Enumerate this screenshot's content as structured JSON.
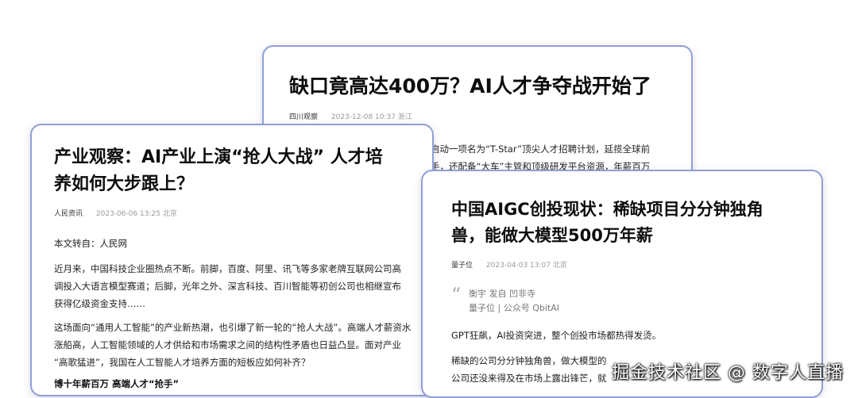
{
  "cards": [
    {
      "title": "缺口竟高达400万？AI人才争夺战开始了",
      "source": "四川观察",
      "date": "2023-12-08 10:37",
      "location": "浙江",
      "lines": [
        "启动一项名为“T-Star”顶尖人才招聘计划，延揽全球前",
        "手，还配备“大车”主管和顶级研发平台资源，年薪百万"
      ]
    },
    {
      "title_line1": "产业观察：AI产业上演“抢人大战” 人才培",
      "title_line2": "养如何大步跟上？",
      "source": "人民资讯",
      "date": "2023-06-06 13:25",
      "location": "北京",
      "repost": "本文转自：人民网",
      "p1": [
        "近月来，中国科技企业圈热点不断。前脚，百度、阿里、讯飞等多家老牌互联网公司高",
        "调投入大语言模型赛道；后脚，光年之外、深言科技、百川智能等初创公司也相继宣布",
        "获得亿级资金支持……"
      ],
      "p2": [
        "这场面向“通用人工智能”的产业新热潮，也引爆了新一轮的“抢人大战”。高端人才薪资水",
        "涨船高，人工智能领域的人才供给和市场需求之间的结构性矛盾也日益凸显。面对产业",
        "“高歌猛进”，我国在人工智能人才培养方面的短板应如何补齐？"
      ],
      "subheading": "博十年薪百万 高端人才“抢手”"
    },
    {
      "title_line1": "中国AIGC创投现状：稀缺项目分分钟独角",
      "title_line2": "兽，能做大模型500万年薪",
      "source": "量子位",
      "date": "2023-04-03 13:07",
      "location": "北京",
      "quote_line1": "衡宇 发自 凹非寺",
      "quote_line2": "量子位 | 公众号 QbitAI",
      "p1": "GPT狂飙，AI投资突进，整个创投市场都热得发烫。",
      "p2": [
        "稀缺的公司分分钟独角兽，做大模型的",
        "公司还没来得及在市场上露出锋芒，就"
      ]
    }
  ],
  "watermark": "掘金技术社区 @ 数字人直播"
}
